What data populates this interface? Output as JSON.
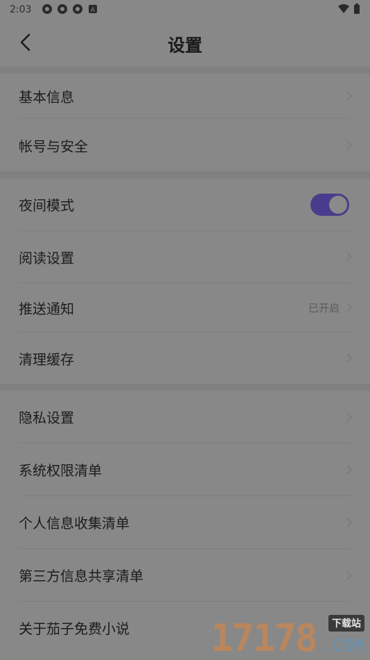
{
  "status_bar": {
    "time": "2:03",
    "icons": [
      "notification-icon",
      "notification-icon",
      "notification-icon",
      "app-icon"
    ],
    "right_icons": [
      "wifi-icon",
      "battery-icon"
    ]
  },
  "header": {
    "title": "设置",
    "back_icon": "back-arrow-icon"
  },
  "groups": [
    {
      "items": [
        {
          "label": "基本信息",
          "type": "link"
        },
        {
          "label": "帐号与安全",
          "type": "link"
        }
      ]
    },
    {
      "items": [
        {
          "label": "夜间模式",
          "type": "toggle",
          "on": true
        },
        {
          "label": "阅读设置",
          "type": "link"
        },
        {
          "label": "推送通知",
          "type": "link",
          "value": "已开启"
        },
        {
          "label": "清理缓存",
          "type": "link"
        }
      ]
    },
    {
      "items": [
        {
          "label": "隐私设置",
          "type": "link"
        },
        {
          "label": "系统权限清单",
          "type": "link"
        },
        {
          "label": "个人信息收集清单",
          "type": "link"
        },
        {
          "label": "第三方信息共享清单",
          "type": "link"
        },
        {
          "label": "关于茄子免费小说",
          "type": "link"
        }
      ]
    }
  ],
  "watermark": {
    "number": "17178",
    "tag": "下载站",
    "suffix": ".COM"
  },
  "colors": {
    "toggle_on": "#4a3c8c",
    "overlay_bg": "#888888"
  }
}
